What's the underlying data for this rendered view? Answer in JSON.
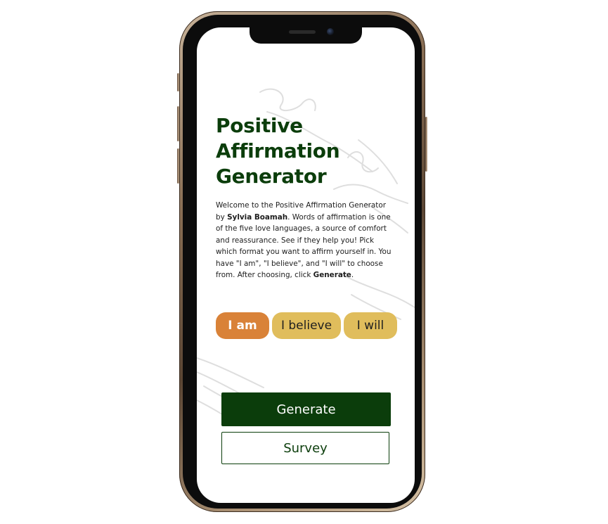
{
  "app": {
    "title": "Positive Affirmation Generator",
    "intro": {
      "part1": "Welcome to the Positive Affirmation Generator by ",
      "author": "Sylvia Boamah",
      "part2": ". Words of affirmation is one of the five love languages, a source of comfort and reassurance. See if they help you! Pick which format you want to affirm yourself in. You have \"I am\", \"I believe\", and \"I will\" to choose from. After choosing, click ",
      "action": "Generate",
      "part3": "."
    }
  },
  "options": [
    {
      "label": "I am",
      "selected": true
    },
    {
      "label": "I believe",
      "selected": false
    },
    {
      "label": "I will",
      "selected": false
    }
  ],
  "actions": {
    "generate_label": "Generate",
    "survey_label": "Survey"
  },
  "colors": {
    "brand_green": "#0b3d0b",
    "selected_option": "#d98238",
    "option": "#e0bd5c"
  }
}
